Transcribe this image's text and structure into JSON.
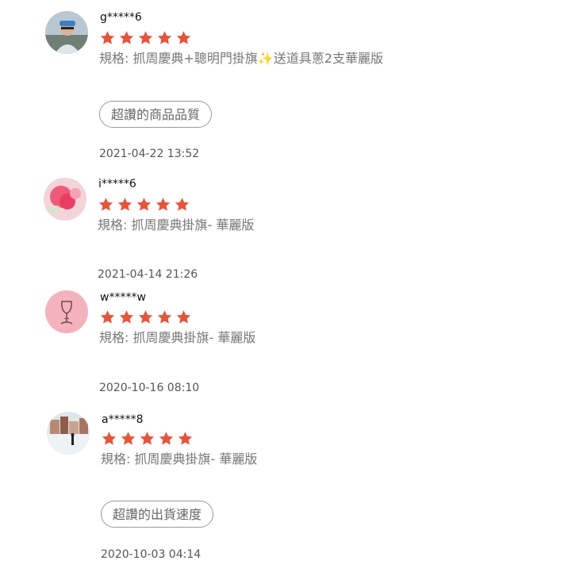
{
  "reviews": [
    {
      "username": "g*****6",
      "rating": 5,
      "variant_label": "規格: 抓周慶典+聰明門掛旗✨送道具蔥2支華麗版",
      "tag": "超讚的商品品質",
      "timestamp": "2021-04-22 13:52"
    },
    {
      "username": "i*****6",
      "rating": 5,
      "variant_label": "規格: 抓周慶典掛旗- 華麗版",
      "timestamp": "2021-04-14 21:26"
    },
    {
      "username": "w*****w",
      "rating": 5,
      "variant_label": "規格: 抓周慶典掛旗- 華麗版",
      "timestamp": "2020-10-16 08:10"
    },
    {
      "username": "a*****8",
      "rating": 5,
      "variant_label": "規格: 抓周慶典掛旗- 華麗版",
      "tag": "超讚的出貨速度",
      "timestamp": "2020-10-03 04:14"
    }
  ],
  "colors": {
    "star": "#e8533a",
    "text_muted": "#777777",
    "tag_border": "#9a9a9a"
  }
}
